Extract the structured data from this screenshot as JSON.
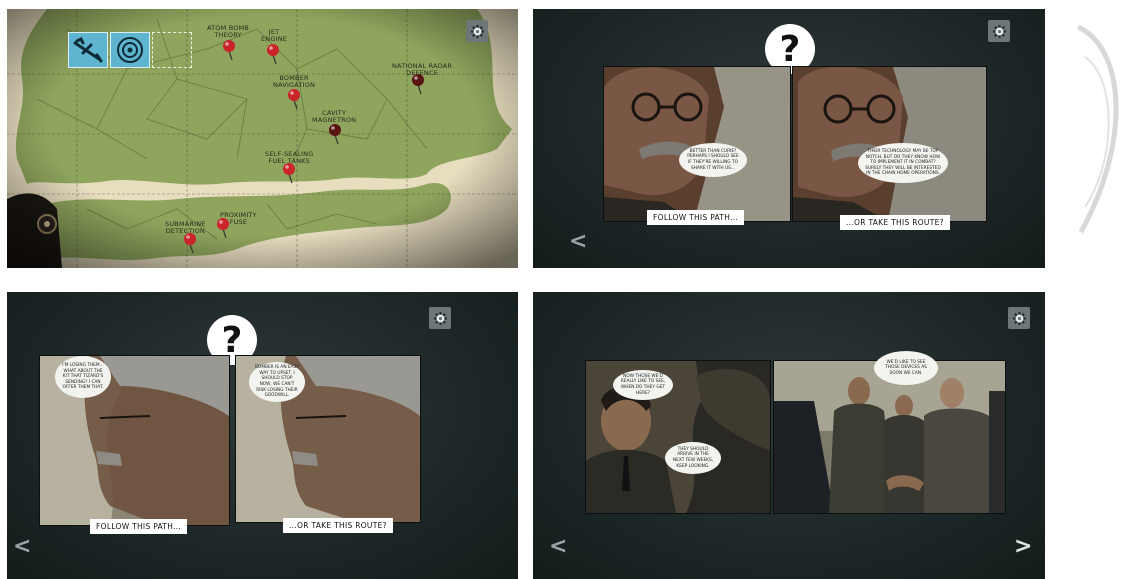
{
  "map_panel": {
    "pins": [
      {
        "label": "ATOM BOMB\nTHEORY",
        "color": "#c9242a"
      },
      {
        "label": "JET\nENGINE",
        "color": "#c9242a"
      },
      {
        "label": "BOMBER\nNAVIGATION",
        "color": "#c9242a"
      },
      {
        "label": "CAVITY\nMAGNETRON",
        "color": "#5a1414"
      },
      {
        "label": "NATIONAL RADAR\nDEFENCE",
        "color": "#5a1414"
      },
      {
        "label": "SELF-SEALING\nFUEL TANKS",
        "color": "#c9242a"
      },
      {
        "label": "PROXIMITY\nFUSE",
        "color": "#c9242a"
      },
      {
        "label": "SUBMARINE\nDETECTION",
        "color": "#c9242a"
      }
    ],
    "inventory": [
      {
        "icon": "airplane-icon"
      },
      {
        "icon": "radar-icon"
      },
      {
        "icon": "empty-slot"
      }
    ]
  },
  "choice_panel_1": {
    "question_mark": "?",
    "thought_left": "BETTER THAN CURIE? PERHAPS I SHOULD SEE IF THEY'RE WILLING TO SHARE IT WITH US...",
    "thought_right": "THEIR TECHNOLOGY MAY BE TOP NOTCH, BUT DO THEY KNOW HOW TO IMPLEMENT IT IN COMBAT? SURELY THEY WILL BE INTERESTED IN THE CHAIN HOME OPERATIONS.",
    "caption_left": "FOLLOW THIS PATH...",
    "caption_right": "...OR TAKE THIS ROUTE?"
  },
  "choice_panel_2": {
    "question_mark": "?",
    "thought_left": "I'M LOSING THEM... WHAT ABOUT THE KIT THAT TIZARD'S SENDING? I CAN OFFER THEM THAT.",
    "thought_right": "BOMBER IS AN EASY WAY TO UPSET. I SHOULD STOP NOW, WE CAN'T RISK LOSING THEIR GOODWILL.",
    "caption_left": "FOLLOW THIS PATH...",
    "caption_right": "...OR TAKE THIS ROUTE?"
  },
  "story_panel": {
    "speech_top": "NOW THOSE WE'D REALLY LIKE TO SEE, WHEN DO THEY GET HERE?",
    "speech_bottom": "THEY SHOULD ARRIVE IN THE NEXT FEW WEEKS, KEEP LOOKING.",
    "speech_right": "WE'D LIKE TO SEE THOSE DEVICES AS SOON WE CAN."
  },
  "nav": {
    "prev": "<",
    "next": ">"
  },
  "colors": {
    "panel_bg": "#1f2a2a",
    "gear_bg": "#6d7777",
    "land": "#8ea35c",
    "sea": "#e6dcc0"
  }
}
